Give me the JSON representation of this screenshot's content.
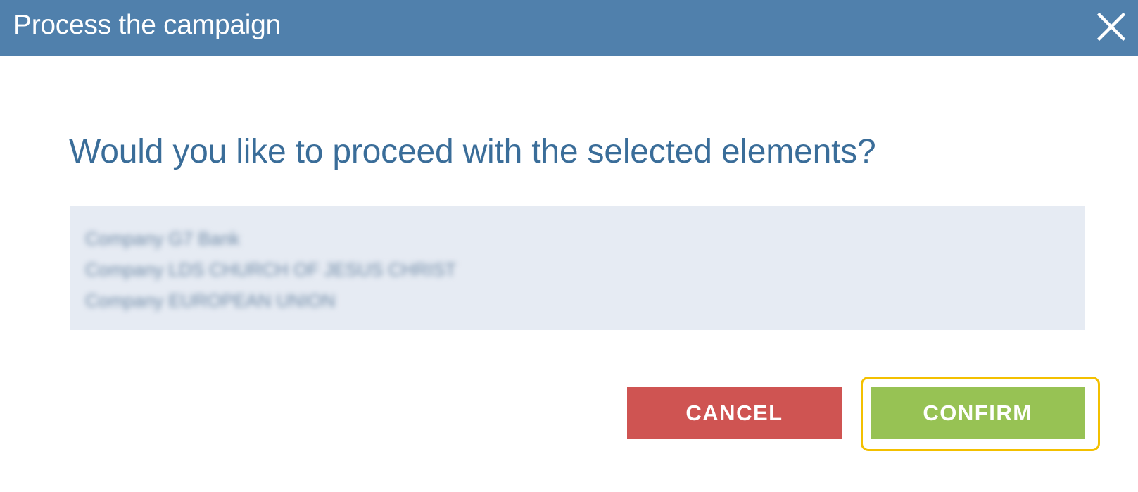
{
  "dialog": {
    "title": "Process the campaign",
    "close_icon": "close-icon",
    "question": "Would you like to proceed with the selected elements?",
    "selected_elements": [
      "Company G7 Bank",
      "Company LDS CHURCH OF JESUS CHRIST",
      "Company EUROPEAN UNION"
    ],
    "buttons": {
      "cancel_label": "CANCEL",
      "confirm_label": "CONFIRM"
    }
  },
  "colors": {
    "titlebar": "#5080ac",
    "question_text": "#3a6d99",
    "list_background": "#e6ebf3",
    "cancel": "#cf5452",
    "confirm": "#97c254",
    "highlight": "#f3c000"
  }
}
